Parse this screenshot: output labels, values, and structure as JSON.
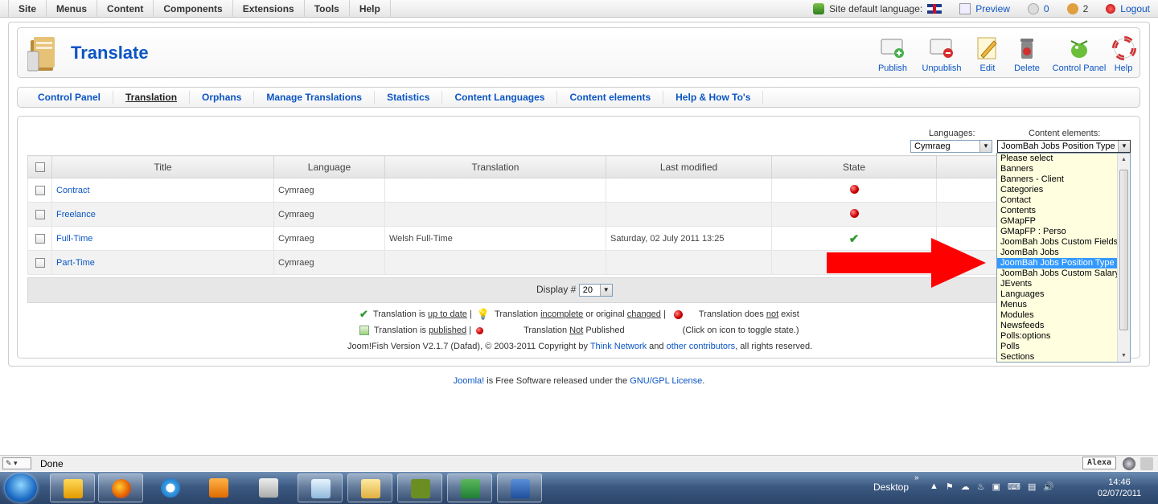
{
  "topmenu": [
    "Site",
    "Menus",
    "Content",
    "Components",
    "Extensions",
    "Tools",
    "Help"
  ],
  "status": {
    "site_language_label": "Site default language:",
    "preview": "Preview",
    "messages_count": "0",
    "users_count": "2",
    "logout": "Logout"
  },
  "header": {
    "title": "Translate",
    "buttons": [
      "Publish",
      "Unpublish",
      "Edit",
      "Delete",
      "Control Panel",
      "Help"
    ]
  },
  "submenu": [
    "Control Panel",
    "Translation",
    "Orphans",
    "Manage Translations",
    "Statistics",
    "Content Languages",
    "Content elements",
    "Help & How To's"
  ],
  "filters": {
    "languages_label": "Languages:",
    "languages_value": "Cymraeg",
    "content_elements_label": "Content elements:",
    "content_elements_value": "JoomBah Jobs Position Type"
  },
  "table": {
    "headers": [
      "Title",
      "Language",
      "Translation",
      "Last modified",
      "State"
    ],
    "rows": [
      {
        "title": "Contract",
        "language": "Cymraeg",
        "translation": "",
        "last_modified": "",
        "state": "not-exist"
      },
      {
        "title": "Freelance",
        "language": "Cymraeg",
        "translation": "",
        "last_modified": "",
        "state": "not-exist"
      },
      {
        "title": "Full-Time",
        "language": "Cymraeg",
        "translation": "Welsh Full-Time",
        "last_modified": "Saturday, 02 July 2011 13:25",
        "state": "up-to-date"
      },
      {
        "title": "Part-Time",
        "language": "Cymraeg",
        "translation": "",
        "last_modified": "",
        "state": "not-exist"
      }
    ]
  },
  "pagination": {
    "display_label": "Display #",
    "display_value": "20"
  },
  "legend": {
    "up_to_date_pre": "Translation is ",
    "up_to_date_link": "up to date",
    "sep": " |",
    "incomplete_pre": "Translation ",
    "incomplete_word": "incomplete",
    "incomplete_mid": " or original ",
    "changed_word": "changed",
    "not_exist_pre": "Translation does ",
    "not_word": "not",
    "not_exist_post": " exist",
    "published_pre": "Translation is ",
    "published_word": "published",
    "not_published_pre": "Translation ",
    "not_published_word": "Not",
    "not_published_post": " Published",
    "toggle_hint": "(Click on icon to toggle state.)"
  },
  "version": {
    "text": "Joom!Fish Version V2.1.7 (Dafad), © 2003-2011 Copyright by ",
    "link1": "Think Network",
    "and": " and ",
    "link2": "other contributors",
    "rights": ", all rights reserved."
  },
  "dropdown_items": [
    "Please select",
    "Banners",
    "Banners - Client",
    "Categories",
    "Contact",
    "Contents",
    "GMapFP",
    "GMapFP : Perso",
    "JoomBah Jobs Custom Fields",
    "JoomBah Jobs",
    "JoomBah Jobs Position Type",
    "JoomBah Jobs Custom Salary",
    "JEvents",
    "Languages",
    "Menus",
    "Modules",
    "Newsfeeds",
    "Polls:options",
    "Polls",
    "Sections"
  ],
  "dropdown_selected_index": 10,
  "footer": {
    "link1": "Joomla!",
    "mid": " is Free Software released under the ",
    "link2": "GNU/GPL License",
    "end": "."
  },
  "browser_status": {
    "text": "Done",
    "alexa": "Alexa"
  },
  "taskbar": {
    "desktop": "Desktop",
    "time": "14:46",
    "date": "02/07/2011",
    "chevron": "»"
  }
}
